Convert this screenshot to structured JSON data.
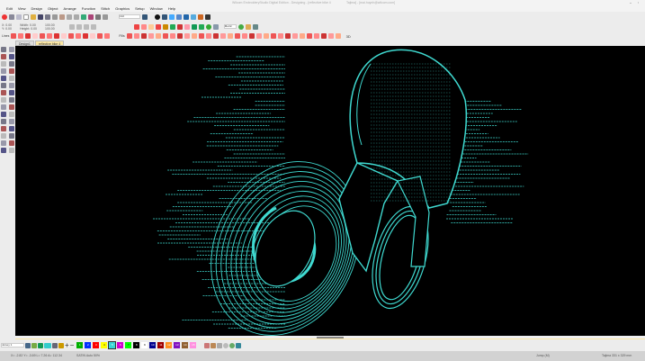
{
  "window": {
    "title": "Wilcom EmbroideryStudio Digital Edition - Designing - [reflective bike 4",
    "title_right": "Tajima] - [mai.huynh@wilcom.com]"
  },
  "menu": [
    "Edit",
    "View",
    "Design",
    "Object",
    "Arrange",
    "Function",
    "Stitch",
    "Graphics",
    "Setup",
    "Window",
    "Help"
  ],
  "toolbar": {
    "zoom_value": "132",
    "units": "Metric",
    "x_label": "X:",
    "x_value": "0.00",
    "y_label": "Y:",
    "y_value": "0.00",
    "width_label": "Width:",
    "width_value": "0.00",
    "height_label": "Height:",
    "height_value": "0.00",
    "w_pct": "100.00",
    "h_pct": "100.00",
    "lines_label": "Lines",
    "fills_label": "Fills",
    "three_d": "3D"
  },
  "tabs": [
    {
      "label": "Design1"
    },
    {
      "label": "reflective bike 4",
      "active": true
    }
  ],
  "bottom": {
    "fabric": "Jersey 1",
    "colors": [
      {
        "n": "1",
        "c": "#00b000"
      },
      {
        "n": "2",
        "c": "#0030ff"
      },
      {
        "n": "3",
        "c": "#ff0000"
      },
      {
        "n": "4",
        "c": "#ffff00"
      },
      {
        "n": "5",
        "c": "#38d6d6",
        "sel": true
      },
      {
        "n": "6",
        "c": "#d000d0"
      },
      {
        "n": "7",
        "c": "#00ff00"
      },
      {
        "n": "8",
        "c": "#000000"
      },
      {
        "n": "9",
        "c": "#ffffff"
      },
      {
        "n": "10",
        "c": "#000090"
      },
      {
        "n": "11",
        "c": "#a00000"
      },
      {
        "n": "12",
        "c": "#ff9020"
      },
      {
        "n": "13",
        "c": "#8010c0"
      },
      {
        "n": "14",
        "c": "#906030"
      },
      {
        "n": "15",
        "c": "#ff90e0"
      }
    ]
  },
  "status": {
    "coords": "X= -2.82  Y= -3.69  L= 7.26  A= 112.34",
    "stitch": "SATIN Auto 50%",
    "jump": "Jump (M)",
    "machine": "Tajima 331 x 329 mm"
  },
  "design_color": "#3fd9d0"
}
